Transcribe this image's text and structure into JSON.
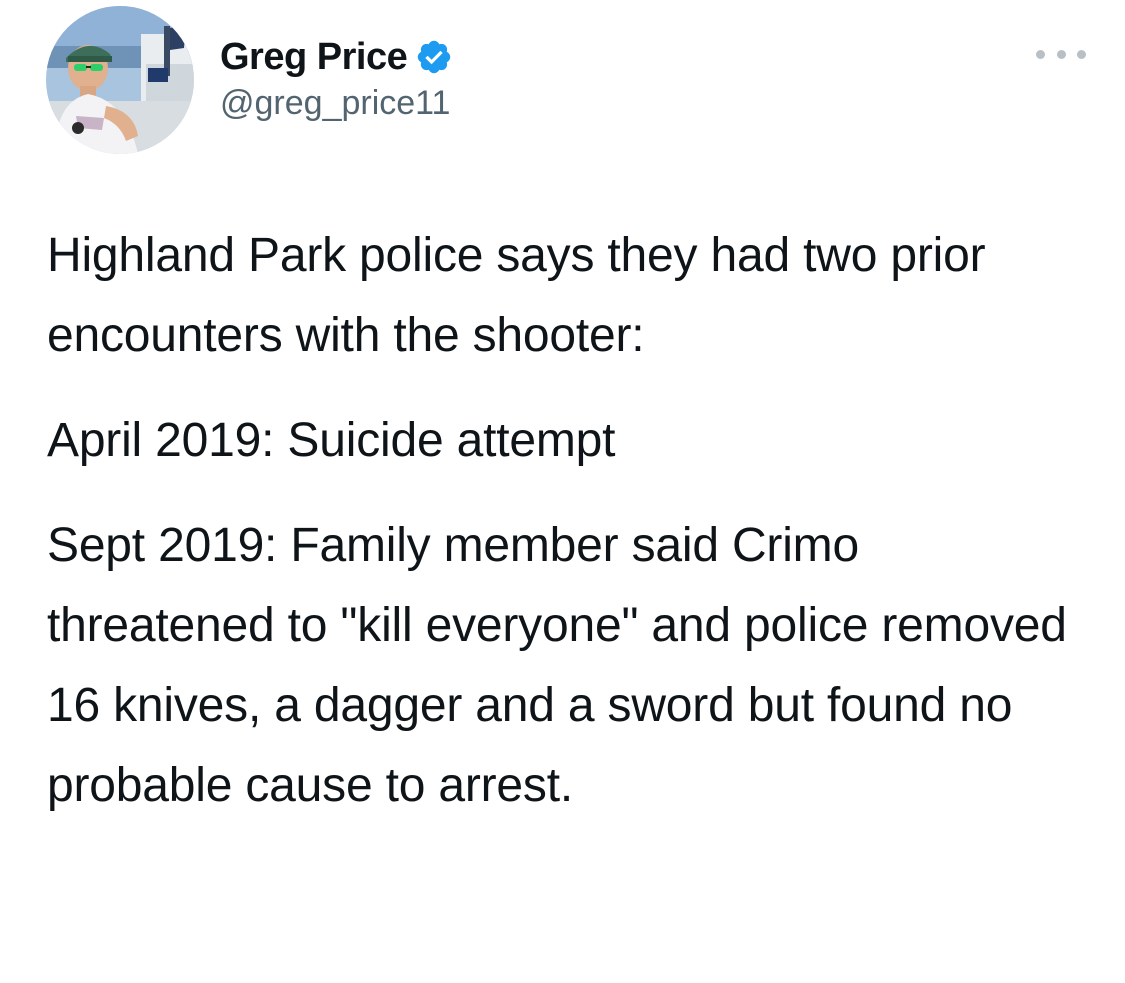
{
  "author": {
    "display_name": "Greg Price",
    "handle": "@greg_price11",
    "verified": true,
    "verified_icon": "verified-badge-icon",
    "accent_color": "#1d9bf0"
  },
  "menu": {
    "icon": "more-horizontal-icon"
  },
  "tweet": {
    "paragraphs": [
      "Highland Park police says they had two prior encounters with the shooter:",
      "April 2019: Suicide attempt",
      "Sept 2019: Family member said Crimo threatened to \"kill everyone\" and police removed 16 knives, a dagger and a sword but found no probable cause to arrest."
    ]
  }
}
